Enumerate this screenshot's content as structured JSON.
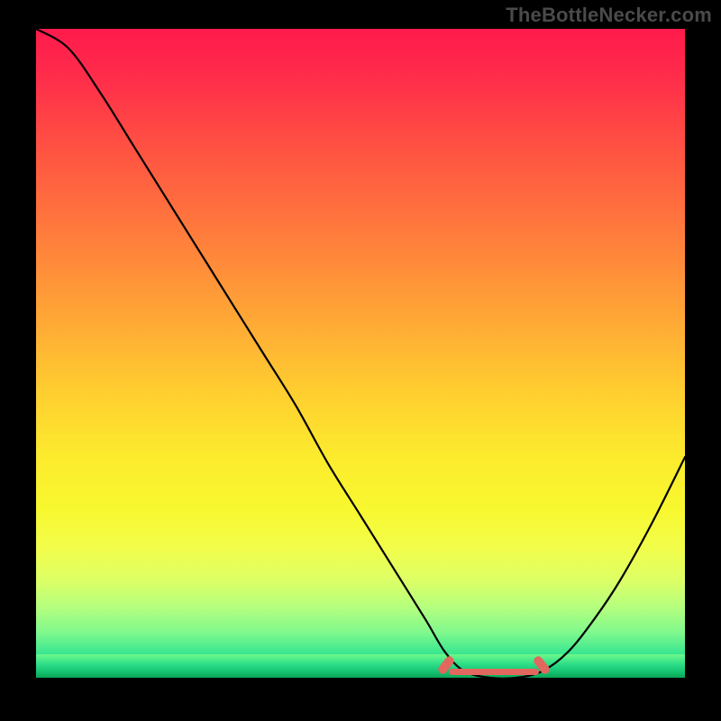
{
  "watermark": "TheBottleNecker.com",
  "chart_data": {
    "type": "line",
    "title": "",
    "xlabel": "",
    "ylabel": "",
    "xlim": [
      0,
      100
    ],
    "ylim": [
      0,
      100
    ],
    "series": [
      {
        "name": "bottleneck-curve",
        "x": [
          0,
          5,
          10,
          15,
          20,
          25,
          30,
          35,
          40,
          45,
          50,
          55,
          60,
          63,
          66,
          70,
          74,
          78,
          82,
          86,
          90,
          95,
          100
        ],
        "y": [
          100,
          97,
          90,
          82,
          74,
          66,
          58,
          50,
          42,
          33,
          25,
          17,
          9,
          4,
          1,
          0,
          0,
          1,
          4,
          9,
          15,
          24,
          34
        ]
      }
    ],
    "annotations": [
      {
        "name": "optimal-range-marker",
        "x_start": 63,
        "x_end": 78,
        "y": 1
      }
    ],
    "background": {
      "type": "vertical-gradient",
      "stops": [
        {
          "pos": 0.0,
          "color": "#ff1a4d"
        },
        {
          "pos": 0.5,
          "color": "#ffc030"
        },
        {
          "pos": 0.8,
          "color": "#f4fb40"
        },
        {
          "pos": 1.0,
          "color": "#0cc96f"
        }
      ]
    }
  }
}
